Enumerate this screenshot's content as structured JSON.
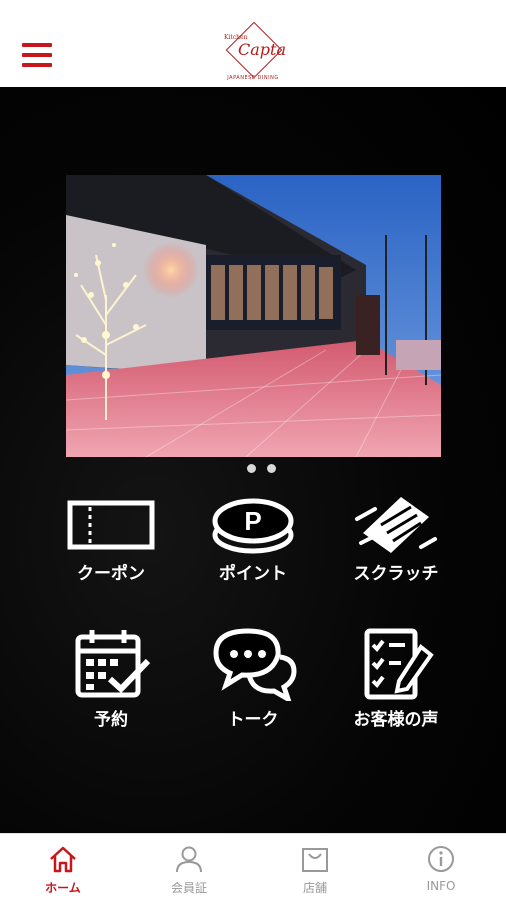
{
  "header": {
    "logo": {
      "small_text": "Kitchen",
      "script_text": "Capta",
      "sub_text": "JAPANESE DINING"
    }
  },
  "slider": {
    "slide_count": 2,
    "active_index": 0
  },
  "menu": [
    {
      "key": "coupon",
      "label": "クーポン",
      "icon": "ticket-icon"
    },
    {
      "key": "point",
      "label": "ポイント",
      "icon": "point-coin-icon"
    },
    {
      "key": "scratch",
      "label": "スクラッチ",
      "icon": "scratch-card-icon"
    },
    {
      "key": "reserve",
      "label": "予約",
      "icon": "calendar-check-icon"
    },
    {
      "key": "talk",
      "label": "トーク",
      "icon": "chat-bubbles-icon"
    },
    {
      "key": "voice",
      "label": "お客様の声",
      "icon": "checklist-pen-icon"
    }
  ],
  "tabs": [
    {
      "key": "home",
      "label": "ホーム",
      "icon": "home-icon",
      "active": true
    },
    {
      "key": "member",
      "label": "会員証",
      "icon": "user-icon",
      "active": false
    },
    {
      "key": "shop",
      "label": "店舗",
      "icon": "shop-bag-icon",
      "active": false
    },
    {
      "key": "info",
      "label": "INFO",
      "icon": "info-icon",
      "active": false
    }
  ],
  "colors": {
    "accent": "#c8161d",
    "background": "#000000",
    "inactive_tab": "#999999"
  }
}
